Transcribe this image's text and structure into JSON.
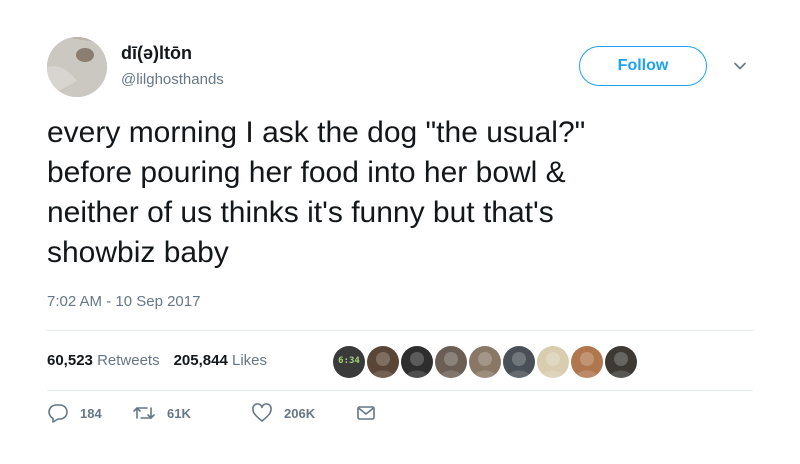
{
  "user": {
    "display_name": "dī(ə)ltōn",
    "handle": "@lilghosthands",
    "follow_label": "Follow"
  },
  "tweet": {
    "text": "every morning I ask the dog \"the usual?\"\nbefore pouring her food into her bowl &\nneither of us thinks it's funny but that's\nshowbiz baby",
    "timestamp": "7:02 AM - 10 Sep 2017"
  },
  "stats": {
    "retweets_count": "60,523",
    "retweets_label": "Retweets",
    "likes_count": "205,844",
    "likes_label": "Likes"
  },
  "liker_avatars": [
    {
      "color": "#3a3a3a",
      "text": "6:34"
    },
    {
      "color": "#5a4636"
    },
    {
      "color": "#2e2e2e"
    },
    {
      "color": "#6b5f55"
    },
    {
      "color": "#8a7866"
    },
    {
      "color": "#4a5058"
    },
    {
      "color": "#d9cdb0"
    },
    {
      "color": "#b0764e"
    },
    {
      "color": "#3d3a36"
    }
  ],
  "actions": {
    "reply_count": "184",
    "retweet_count": "61K",
    "like_count": "206K"
  },
  "colors": {
    "accent": "#1da1f2",
    "secondary_text": "#657786",
    "divider": "#e6ecf0"
  }
}
